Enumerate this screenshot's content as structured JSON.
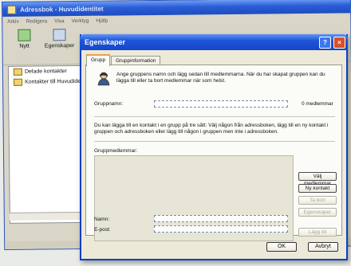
{
  "back_window": {
    "title": "Adressbok - Huvudidentitet",
    "menu": [
      "Arkiv",
      "Redigera",
      "Visa",
      "Verktyg",
      "Hjälp"
    ],
    "toolbar": [
      {
        "label": "Nytt",
        "icon": "new-contact-icon"
      },
      {
        "label": "Egenskaper",
        "icon": "properties-icon"
      }
    ],
    "tree": [
      {
        "label": "Delade kontakter",
        "icon": "folder-icon"
      },
      {
        "label": "Kontakter till Huvudidentitet",
        "icon": "folder-icon"
      }
    ]
  },
  "dialog": {
    "title": "Egenskaper",
    "help_label": "?",
    "close_label": "×",
    "tabs": [
      {
        "label": "Grupp",
        "active": true
      },
      {
        "label": "Gruppinformation",
        "active": false
      }
    ],
    "intro": "Ange gruppens namn och lägg sedan till medlemmarna. När du har skapat gruppen kan du lägga till eller ta bort medlemmar när som helst.",
    "group_name_label": "Gruppnamn:",
    "group_name_value": "",
    "member_count": "0 medlemmar",
    "info": "Du kan lägga till en kontakt i en grupp på tre sätt: Välj någon från adressboken, lägg till en ny kontakt i gruppen och adressboken eller lägg till någon i gruppen men inte i adressboken.",
    "members_label": "Gruppmedlemmar:",
    "buttons": {
      "select_members": "Välj medlemmar",
      "new_contact": "Ny kontakt",
      "remove": "Ta bort",
      "properties": "Egenskaper",
      "add": "Lägg till"
    },
    "name_label": "Namn:",
    "name_value": "",
    "email_label": "E-post:",
    "email_value": "",
    "ok_label": "OK",
    "cancel_label": "Avbryt"
  },
  "colors": {
    "titlebar": "#1e55d8",
    "dialog_bg": "#ece9d8",
    "pane_bg": "#fbfbf7",
    "tab_accent": "#f0a13a",
    "close_button": "#d9502c"
  }
}
